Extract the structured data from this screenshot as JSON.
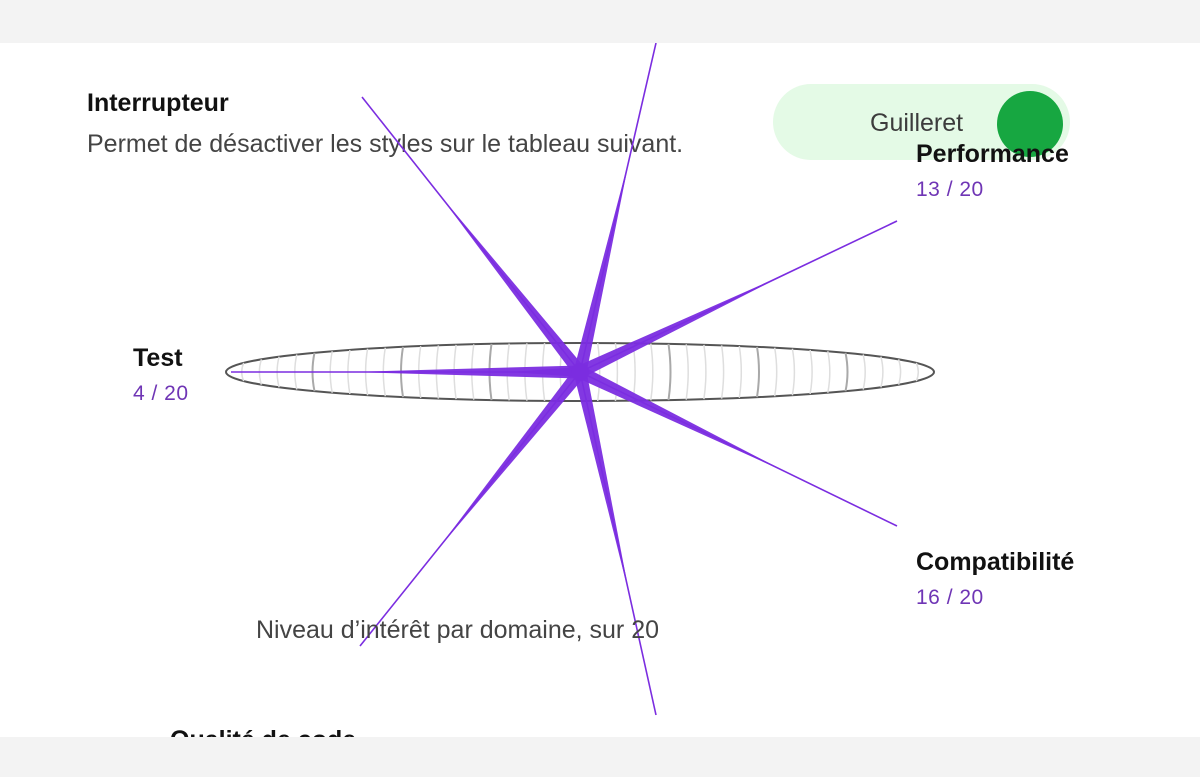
{
  "switch": {
    "title": "Interrupteur",
    "description": "Permet de désactiver les styles sur le tableau suivant.",
    "toggle_label": "Guilleret",
    "toggle_on": true,
    "toggle_track_color": "#e4fae6",
    "toggle_knob_color": "#17a741"
  },
  "chart": {
    "caption": "Niveau d’intérêt par domaine, sur 20",
    "accent_color": "#7b2de0",
    "axes": [
      {
        "name": "Performance",
        "score": "13 / 20"
      },
      {
        "name": "Compatibilité",
        "score": "16 / 20"
      },
      {
        "name": "Qualité de code",
        "score": ""
      },
      {
        "name": "Test",
        "score": "4 / 20"
      }
    ]
  },
  "chart_data": {
    "type": "radar",
    "title": "",
    "caption": "Niveau d’intérêt par domaine, sur 20",
    "max": 20,
    "categories": [
      "Performance",
      "Compatibilité",
      "Qualité de code",
      "Test"
    ],
    "values": [
      13,
      16,
      null,
      4
    ]
  }
}
